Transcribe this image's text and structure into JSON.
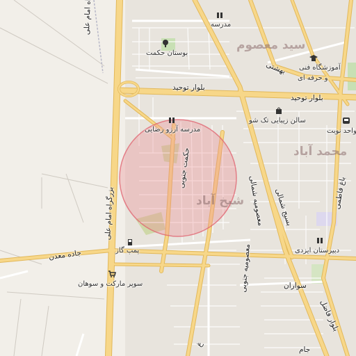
{
  "map": {
    "accent_road_color": "#f7d789",
    "highlight_circle_color": "#ea8b93",
    "background_color": "#f2efe9"
  },
  "districts": {
    "seyed_masoum": "سید معصوم",
    "mohammad_abad": "محمد آباد",
    "sheikh_abad": "شیخ آباد"
  },
  "roads": {
    "imam_ali_top": "بزرگراه امام علی",
    "imam_ali_bottom": "بزرگراه امام علی",
    "tohid": "بلوار توحید",
    "tohid_east": "بلوار توحید",
    "beheshti": "بهشتی",
    "jadeh_maadan": "جاده معدن",
    "basij_north": "بسیج شمالی",
    "masoumiyeh_north": "معصومیه شمالی",
    "hekmat_south": "حکمت جنوبی",
    "savaran": "سواران",
    "masoumiyeh_south": "معصومیه جنوبی",
    "fazel": "بلوار فاضل",
    "bagh_fatemi": "باغ فاطمی",
    "small_g": "غ",
    "small_jam": "جام"
  },
  "pois": {
    "madrese": "مدرسه",
    "bustan_hekmat": "بوستان حکمت",
    "amuzeshgah_1": "آموزشگاه فنی",
    "amuzeshgah_2": "و حرفه ای",
    "salon": "سالن زیبایی تک شو",
    "madrese_arezu": "مدرسه آرزو رضایی",
    "vahed_nobat": "ط واحد نوبت",
    "pomp_gaz": "پمپ گاز",
    "super_market": "سوپر مارکت و سوهان",
    "dabirestan": "دبیرستان ایزدی"
  },
  "icons": {
    "school": "school-icon",
    "park": "tree-icon",
    "education": "graduation-cap-icon",
    "shop": "shopping-bag-icon",
    "bus": "bus-icon",
    "fuel": "fuel-icon",
    "store": "cart-icon"
  }
}
